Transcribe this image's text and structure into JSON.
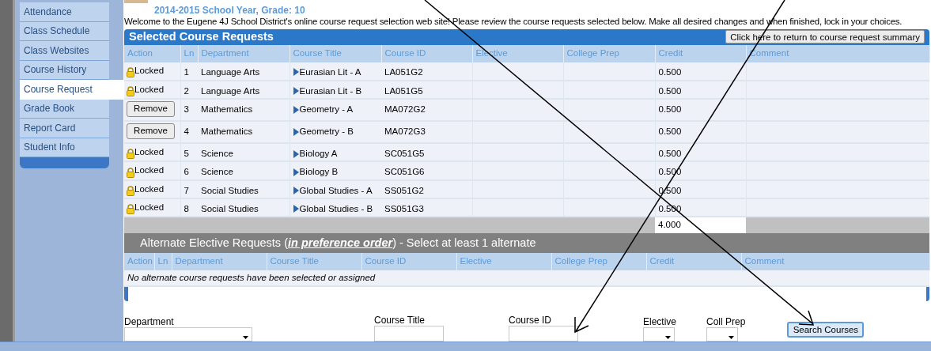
{
  "sidebar": {
    "items": [
      {
        "label": "Attendance",
        "selected": false
      },
      {
        "label": "Class Schedule",
        "selected": false
      },
      {
        "label": "Class Websites",
        "selected": false
      },
      {
        "label": "Course History",
        "selected": false
      },
      {
        "label": "Course Request",
        "selected": true
      },
      {
        "label": "Grade Book",
        "selected": false
      },
      {
        "label": "Report Card",
        "selected": false
      },
      {
        "label": "Student Info",
        "selected": false
      }
    ]
  },
  "header": {
    "school_year": "2014-2015 School Year, Grade: 10",
    "welcome": "Welcome to the Eugene 4J School District's online course request selection web site! Please review the course requests selected below. Make all desired changes and when finished, lock in your choices."
  },
  "selected_requests": {
    "title": "Selected Course Requests",
    "summary_button": "Click here to return to course request summary",
    "columns": [
      "Action",
      "Ln",
      "Department",
      "Course Title",
      "Course ID",
      "Elective",
      "College Prep",
      "Credit",
      "Comment"
    ],
    "rows": [
      {
        "action": {
          "kind": "locked",
          "label": "Locked"
        },
        "ln": "1",
        "department": "Language Arts",
        "course_title": "Eurasian Lit - A",
        "course_id": "LA051G2",
        "credit": "0.500"
      },
      {
        "action": {
          "kind": "locked",
          "label": "Locked"
        },
        "ln": "2",
        "department": "Language Arts",
        "course_title": "Eurasian Lit - B",
        "course_id": "LA051G5",
        "credit": "0.500"
      },
      {
        "action": {
          "kind": "button",
          "label": "Remove"
        },
        "ln": "3",
        "department": "Mathematics",
        "course_title": "Geometry - A",
        "course_id": "MA072G2",
        "credit": "0.500"
      },
      {
        "action": {
          "kind": "button",
          "label": "Remove"
        },
        "ln": "4",
        "department": "Mathematics",
        "course_title": "Geometry - B",
        "course_id": "MA072G3",
        "credit": "0.500"
      },
      {
        "action": {
          "kind": "locked",
          "label": "Locked"
        },
        "ln": "5",
        "department": "Science",
        "course_title": "Biology A",
        "course_id": "SC051G5",
        "credit": "0.500"
      },
      {
        "action": {
          "kind": "locked",
          "label": "Locked"
        },
        "ln": "6",
        "department": "Science",
        "course_title": "Biology B",
        "course_id": "SC051G6",
        "credit": "0.500"
      },
      {
        "action": {
          "kind": "locked",
          "label": "Locked"
        },
        "ln": "7",
        "department": "Social Studies",
        "course_title": "Global Studies - A",
        "course_id": "SS051G2",
        "credit": "0.500"
      },
      {
        "action": {
          "kind": "locked",
          "label": "Locked"
        },
        "ln": "8",
        "department": "Social Studies",
        "course_title": "Global Studies - B",
        "course_id": "SS051G3",
        "credit": "0.500"
      }
    ],
    "total_credit": "4.000"
  },
  "alternate_requests": {
    "title_prefix": "Alternate Elective Requests (",
    "title_emphasis": "in preference order",
    "title_suffix": ") - Select at least 1 alternate",
    "columns": [
      "Action",
      "Ln",
      "Department",
      "Course Title",
      "Course ID",
      "Elective",
      "College Prep",
      "Credit",
      "Comment"
    ],
    "empty_message": "No alternate course requests have been selected or assigned"
  },
  "search_form": {
    "fields": [
      {
        "label": "Department",
        "kind": "select"
      },
      {
        "label": "Course Title",
        "kind": "text"
      },
      {
        "label": "Course ID",
        "kind": "text"
      },
      {
        "label": "Elective",
        "kind": "select"
      },
      {
        "label": "Coll Prep",
        "kind": "select"
      }
    ],
    "button": "Search Courses"
  }
}
